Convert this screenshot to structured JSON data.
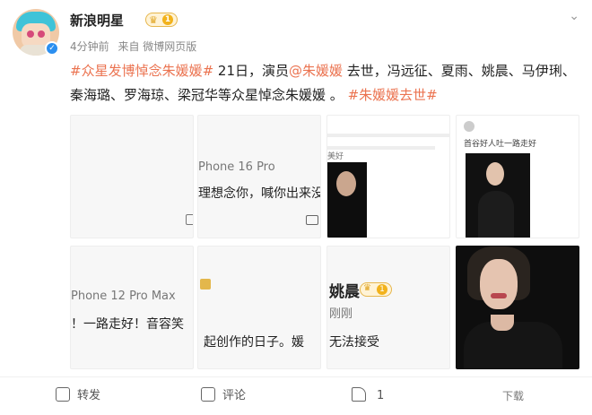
{
  "user": {
    "name": "新浪明星",
    "vip_level": "1",
    "time": "4分钟前",
    "source": "来自 微博网页版"
  },
  "post": {
    "tag1": "#众星发博悼念朱媛媛#",
    "text1": " 21日，演员",
    "mention": "@朱媛媛",
    "text2": " 去世，冯远征、夏雨、姚晨、马伊琍、秦海璐、罗海琼、梁冠华等众星悼念朱媛媛 。",
    "tag2": "#朱媛媛去世#"
  },
  "images": {
    "cell1": {},
    "cell2": {
      "device": "Phone 16 Pro",
      "line": "理想念你，喊你出来没"
    },
    "cell3": {
      "line": "美好"
    },
    "cell4": {
      "line": "首谷好人吐一路走好"
    },
    "cell5": {
      "device": "Phone 12 Pro Max",
      "line": "！一路走好！音容笑"
    },
    "cell6": {
      "line": "起创作的日子。媛"
    },
    "cell7": {
      "name": "姚晨",
      "vip": "1",
      "sub": "刚刚",
      "line": "无法接受"
    },
    "cell8": {}
  },
  "actions": {
    "repost": "转发",
    "comment": "评论",
    "like_count": "1",
    "more": "下载"
  },
  "colors": {
    "tag": "#eb7350",
    "verified": "#2b8ff0"
  }
}
